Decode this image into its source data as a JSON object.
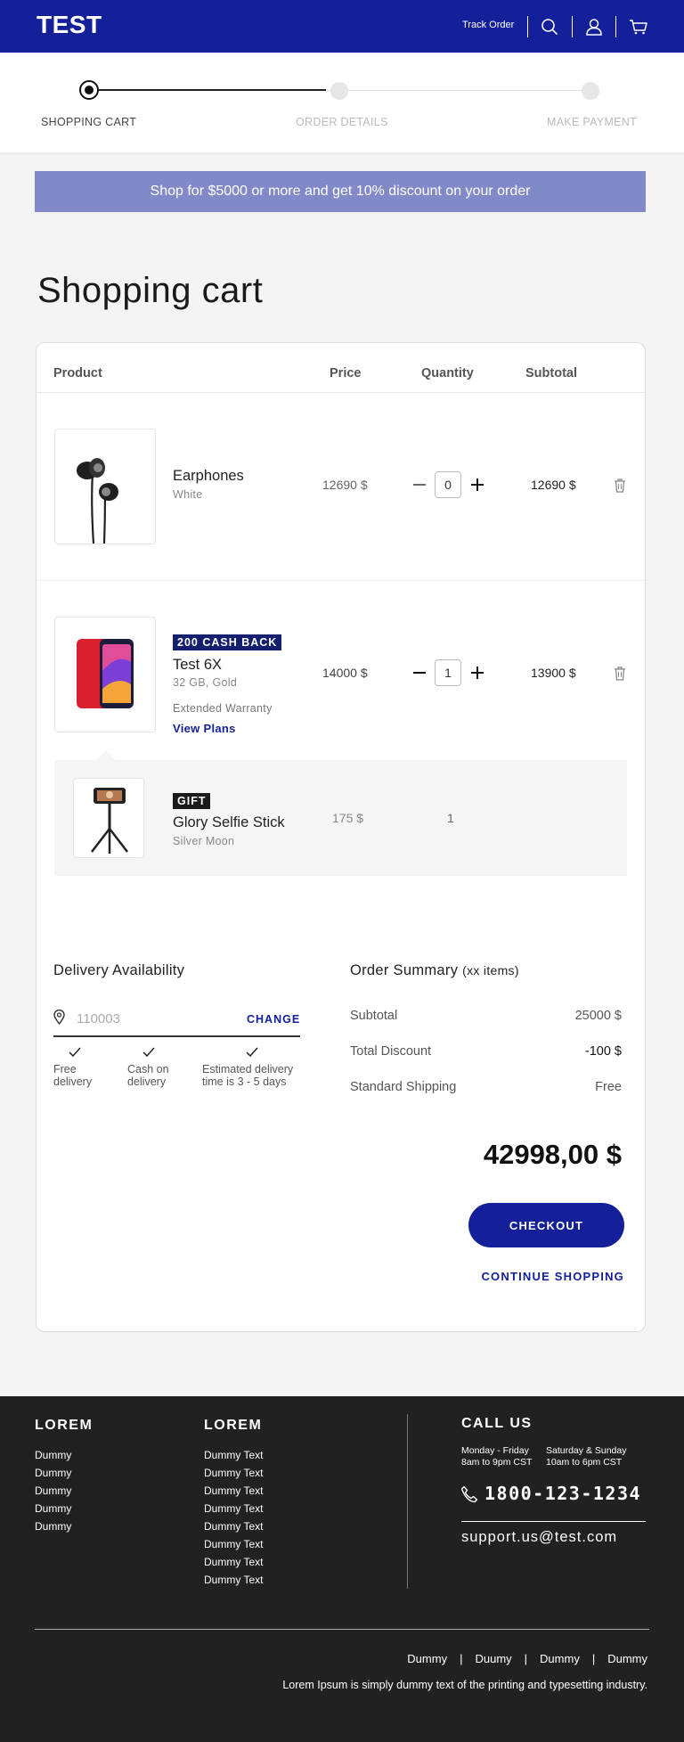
{
  "header": {
    "logo": "TEST",
    "track_order": "Track Order",
    "icons": [
      "search-icon",
      "user-icon",
      "cart-icon"
    ]
  },
  "stepper": {
    "steps": [
      {
        "label": "SHOPPING CART",
        "active": true
      },
      {
        "label": "ORDER DETAILS",
        "active": false
      },
      {
        "label": "MAKE PAYMENT",
        "active": false
      }
    ]
  },
  "banner": {
    "text": "Shop for $5000 or more and get 10% discount on your order"
  },
  "page_title": "Shopping cart",
  "table": {
    "headers": {
      "product": "Product",
      "price": "Price",
      "quantity": "Quantity",
      "subtotal": "Subtotal"
    }
  },
  "items": [
    {
      "name": "Earphones",
      "variant": "White",
      "price": "12690 $",
      "qty": "0",
      "subtotal": "12690 $"
    },
    {
      "badge": "200 CASH BACK",
      "name": "Test 6X",
      "variant": "32 GB, Gold",
      "warranty": "Extended Warranty",
      "view_plans": "View Plans",
      "price": "14000 $",
      "qty": "1",
      "subtotal": "13900 $"
    }
  ],
  "gift": {
    "badge": "GIFT",
    "name": "Glory Selfie Stick",
    "variant": "Silver Moon",
    "price": "175 $",
    "qty": "1"
  },
  "delivery": {
    "title": "Delivery Availability",
    "pincode": "110003",
    "change": "CHANGE",
    "features": [
      {
        "line1": "Free",
        "line2": "delivery"
      },
      {
        "line1": "Cash on",
        "line2": "delivery"
      },
      {
        "line1": "Estimated delivery",
        "line2": "time is 3 - 5 days"
      }
    ]
  },
  "summary": {
    "title": "Order Summary",
    "items_note": "(xx items)",
    "rows": [
      {
        "label": "Subtotal",
        "value": "25000 $"
      },
      {
        "label": "Total Discount",
        "value": "-100 $"
      },
      {
        "label": "Standard Shipping",
        "value": "Free"
      }
    ],
    "total": "42998,00 $",
    "checkout": "CHECKOUT",
    "continue": "CONTINUE SHOPPING"
  },
  "footer": {
    "col1": {
      "heading": "LOREM",
      "links": [
        "Dummy",
        "Dummy",
        "Dummy",
        "Dummy",
        "Dummy"
      ]
    },
    "col2": {
      "heading": "LOREM",
      "links": [
        "Dummy Text",
        "Dummy Text",
        "Dummy Text",
        "Dummy Text",
        "Dummy Text",
        "Dummy Text",
        "Dummy Text",
        "Dummy Text"
      ]
    },
    "call": {
      "heading": "CALL US",
      "hours1a": "Monday - Friday",
      "hours1b": "8am to 9pm CST",
      "hours2a": "Saturday & Sunday",
      "hours2b": "10am to 6pm CST",
      "phone": "1800-123-1234",
      "email": "support.us@test.com"
    },
    "bottom_links": [
      "Dummy",
      "Duumy",
      "Dummy",
      "Dummy"
    ],
    "copyright": "Lorem Ipsum is simply dummy text of the printing and typesetting industry."
  }
}
